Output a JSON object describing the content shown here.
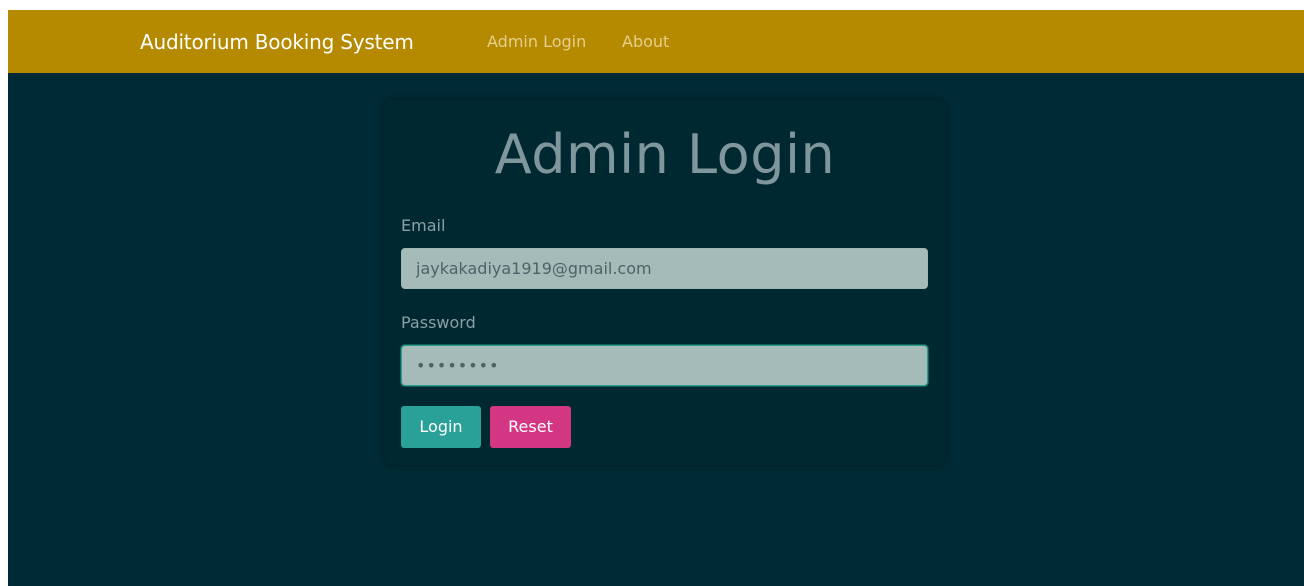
{
  "navbar": {
    "brand": "Auditorium Booking System",
    "links": [
      "Admin Login",
      "About"
    ]
  },
  "login_card": {
    "title": "Admin Login",
    "email": {
      "label": "Email",
      "value": "jaykakadiya1919@gmail.com"
    },
    "password": {
      "label": "Password",
      "value": "••••••••"
    },
    "buttons": {
      "login_label": "Login",
      "reset_label": "Reset"
    }
  },
  "colors": {
    "navbar_background": "#b58900",
    "page_background": "#002b36",
    "login_button": "#2aa198",
    "reset_button": "#d33682"
  }
}
